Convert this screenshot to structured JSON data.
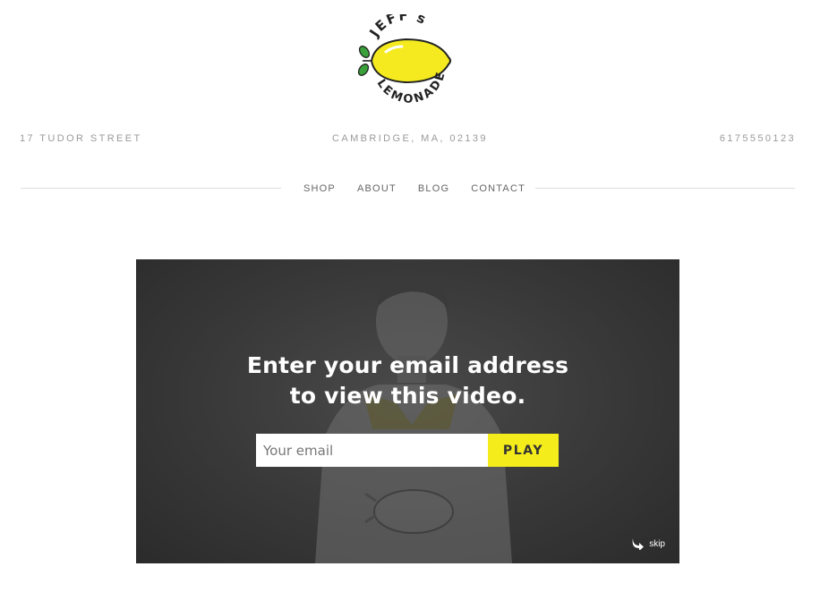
{
  "brand": {
    "top_word": "JEFF's",
    "bottom_word": "LEMONADE",
    "lemon_color": "#f4ea1f",
    "leaf_color": "#3aa13a"
  },
  "contact": {
    "address": "17 TUDOR STREET",
    "city": "CAMBRIDGE, MA, 02139",
    "phone": "6175550123"
  },
  "nav": {
    "items": [
      "SHOP",
      "ABOUT",
      "BLOG",
      "CONTACT"
    ]
  },
  "video": {
    "headline_line1": "Enter your email address",
    "headline_line2": "to view this video.",
    "email_placeholder": "Your email",
    "play_label": "PLAY",
    "skip_label": "skip",
    "accent_color": "#f5ec1c"
  }
}
